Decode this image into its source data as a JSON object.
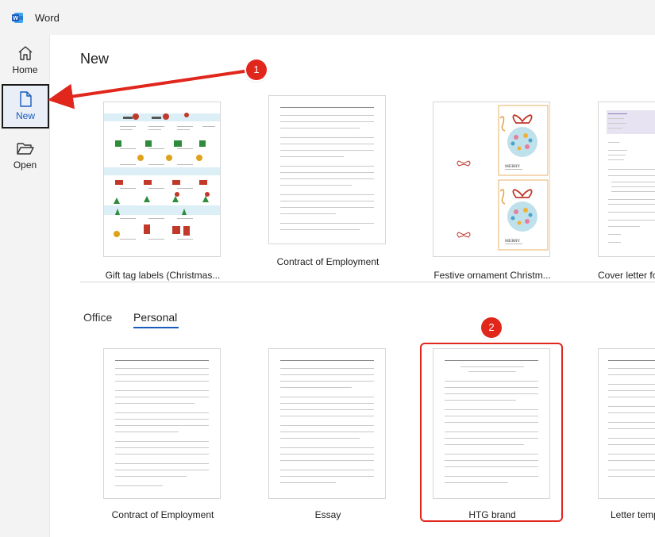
{
  "app": {
    "title": "Word"
  },
  "rail": {
    "items": [
      {
        "label": "Home",
        "icon": "home-icon"
      },
      {
        "label": "New",
        "icon": "new-document-icon",
        "selected": true
      },
      {
        "label": "Open",
        "icon": "folder-open-icon"
      }
    ]
  },
  "main": {
    "title": "New",
    "featured": [
      {
        "label": "Gift tag labels (Christmas..."
      },
      {
        "label": "Contract of Employment"
      },
      {
        "label": "Festive ornament Christm..."
      },
      {
        "label": "Cover letter for"
      }
    ],
    "tabs": [
      {
        "label": "Office"
      },
      {
        "label": "Personal",
        "active": true
      }
    ],
    "personal": [
      {
        "label": "Contract of Employment"
      },
      {
        "label": "Essay"
      },
      {
        "label": "HTG brand"
      },
      {
        "label": "Letter temp"
      }
    ],
    "festive_text": [
      "MERRY",
      "MERRY"
    ]
  },
  "annotations": [
    {
      "number": "1"
    },
    {
      "number": "2"
    }
  ],
  "colors": {
    "accent": "#185abd",
    "annotation": "#e1261c"
  }
}
